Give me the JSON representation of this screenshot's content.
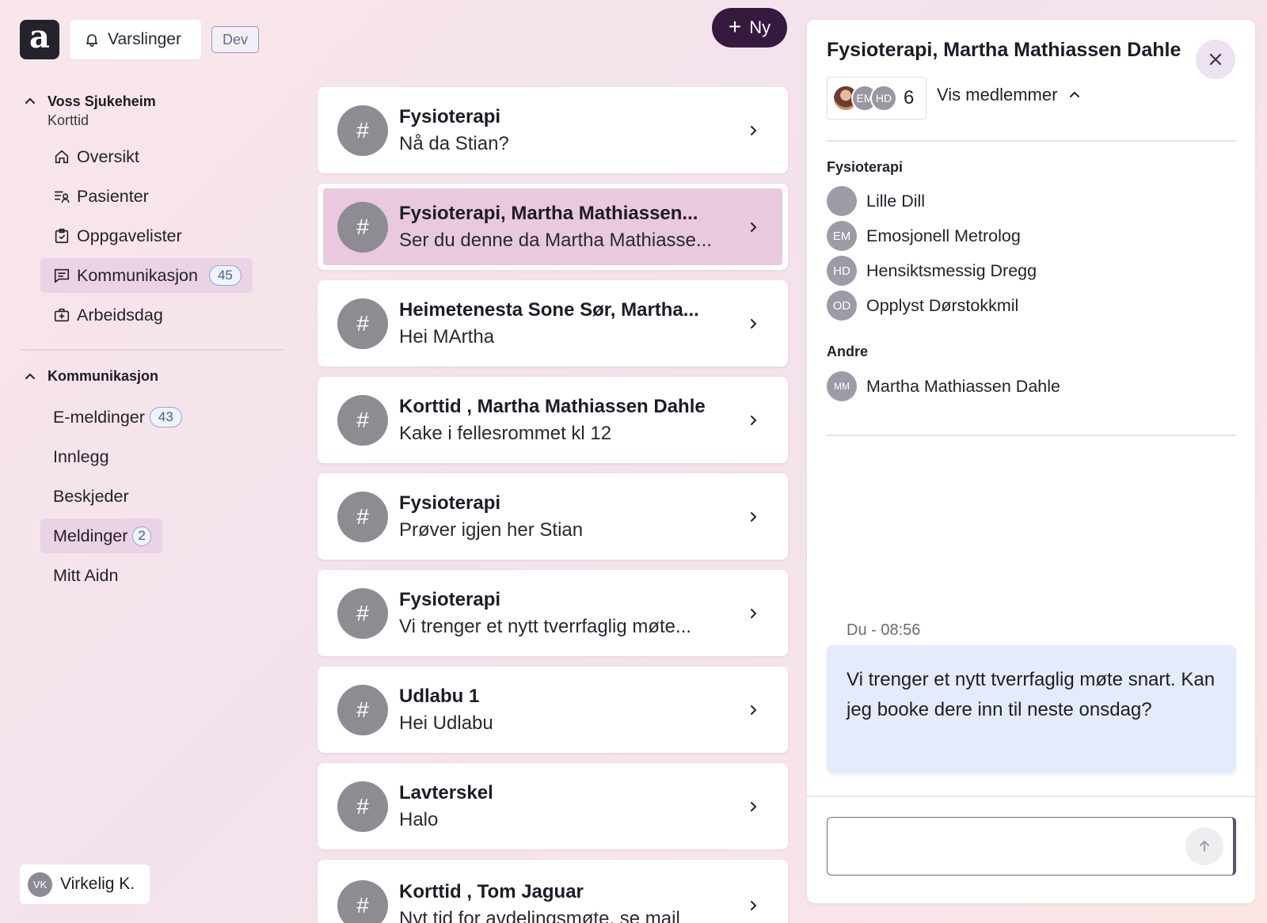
{
  "header": {
    "logo_letter": "a",
    "notifications_label": "Varslinger",
    "env_badge": "Dev",
    "new_button_label": "Ny"
  },
  "sidebar": {
    "org_name": "Voss Sjukeheim",
    "org_unit": "Korttid",
    "nav_items": [
      {
        "label": "Oversikt",
        "icon": "home-icon"
      },
      {
        "label": "Pasienter",
        "icon": "patient-list-icon"
      },
      {
        "label": "Oppgavelister",
        "icon": "clipboard-check-icon"
      },
      {
        "label": "Kommunikasjon",
        "icon": "message-icon",
        "count": "45",
        "active": true
      },
      {
        "label": "Arbeidsdag",
        "icon": "medical-bag-icon"
      }
    ],
    "section_title": "Kommunikasjon",
    "sub_items": [
      {
        "label": "E-meldinger",
        "count": "43"
      },
      {
        "label": "Innlegg"
      },
      {
        "label": "Beskjeder"
      },
      {
        "label": "Meldinger",
        "count": "2",
        "active": true
      },
      {
        "label": "Mitt Aidn"
      }
    ],
    "user": {
      "initials": "VK",
      "name": "Virkelig K."
    }
  },
  "conversations": [
    {
      "title": "Fysioterapi",
      "preview": "Nå da Stian?"
    },
    {
      "title": "Fysioterapi, Martha Mathiassen...",
      "preview": "Ser du denne da Martha Mathiasse...",
      "active": true
    },
    {
      "title": "Heimetenesta Sone Sør, Martha...",
      "preview": "Hei MArtha"
    },
    {
      "title": "Korttid , Martha Mathiassen Dahle",
      "preview": "Kake i fellesrommet kl 12"
    },
    {
      "title": "Fysioterapi",
      "preview": "Prøver igjen her Stian"
    },
    {
      "title": "Fysioterapi",
      "preview": "Vi trenger et nytt tverrfaglig møte..."
    },
    {
      "title": "Udlabu 1",
      "preview": "Hei Udlabu"
    },
    {
      "title": "Lavterskel",
      "preview": "Halo"
    },
    {
      "title": "Korttid , Tom Jaguar",
      "preview": "Nyt tid for avdelingsmøte, se mail"
    }
  ],
  "conversation_icon_glyph": "#",
  "detail": {
    "title": "Fysioterapi, Martha Mathiassen Dahle",
    "member_stack": [
      "EM",
      "HD"
    ],
    "member_count": "6",
    "show_members_label": "Vis medlemmer",
    "groups": [
      {
        "label": "Fysioterapi",
        "members": [
          {
            "initials": "",
            "name": "Lille Dill",
            "photo": true
          },
          {
            "initials": "EM",
            "name": "Emosjonell Metrolog"
          },
          {
            "initials": "HD",
            "name": "Hensiktsmessig Dregg"
          },
          {
            "initials": "OD",
            "name": "Opplyst Dørstokkmil"
          }
        ]
      },
      {
        "label": "Andre",
        "members": [
          {
            "initials": "MM",
            "name": "Martha Mathiassen Dahle"
          }
        ]
      }
    ],
    "message": {
      "meta": "Du - 08:56",
      "text": "Vi trenger et nytt tverrfaglig møte snart. Kan jeg booke dere inn til neste onsdag?"
    },
    "composer_value": ""
  },
  "colors": {
    "accent_dark": "#36193f",
    "active_item": "#ead3e4",
    "active_conversation": "#e8c9de",
    "badge_border": "#8fa8d8",
    "message_bubble": "#e5ebfb"
  }
}
